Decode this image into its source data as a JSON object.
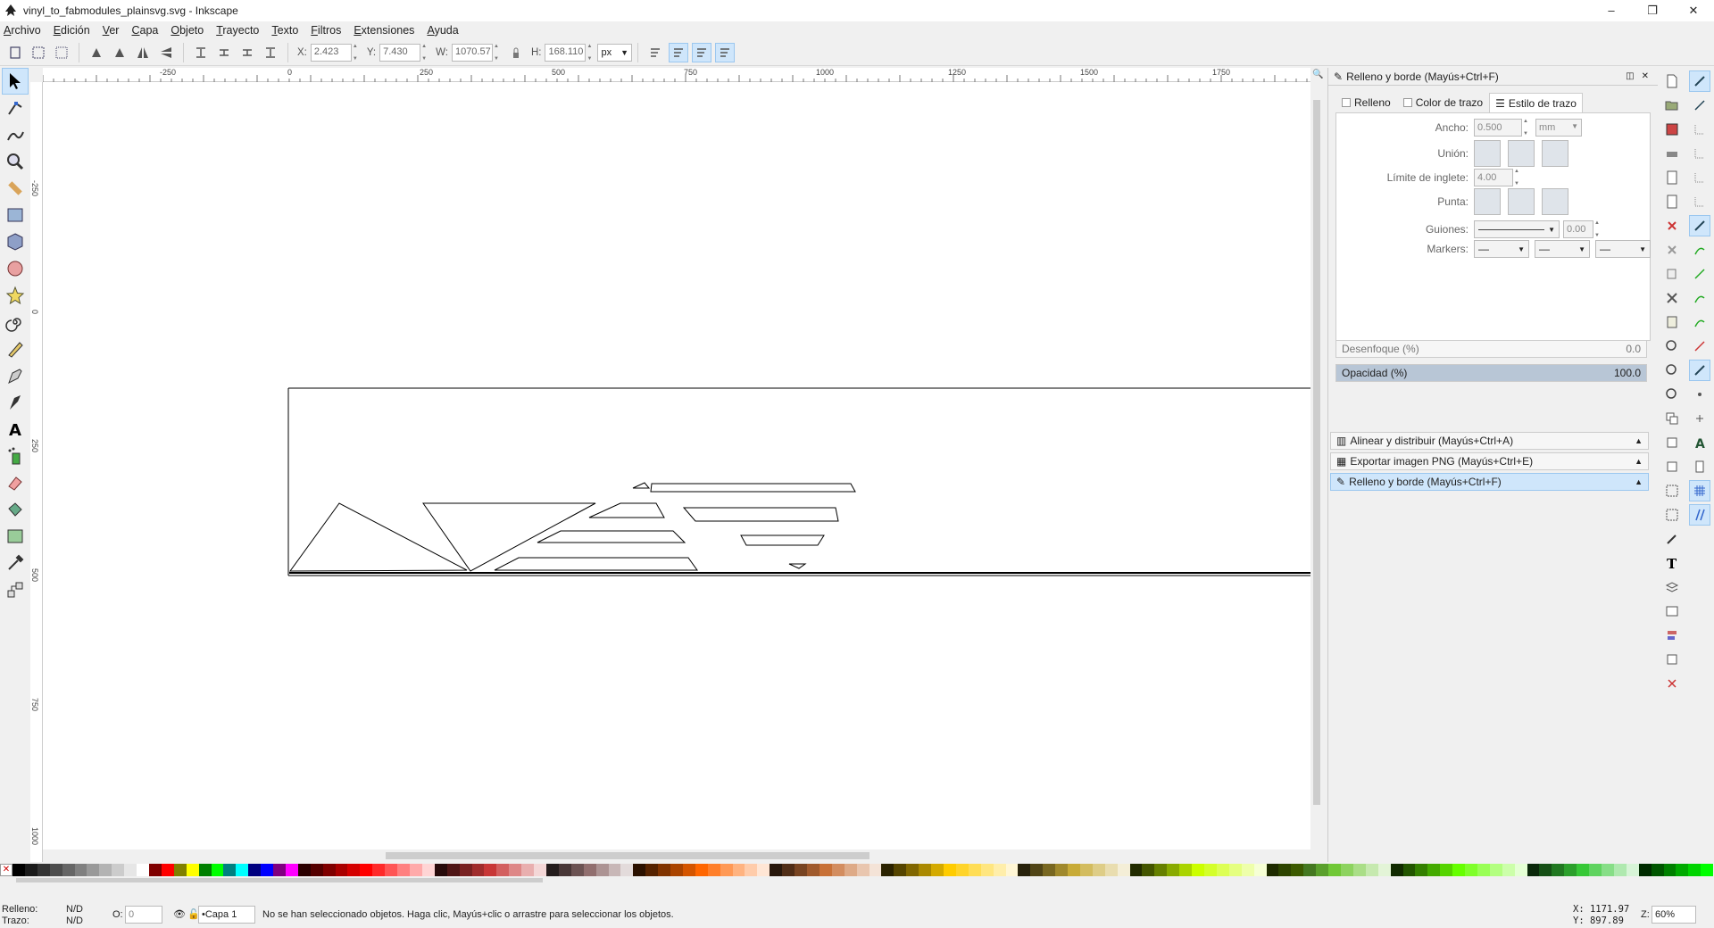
{
  "window": {
    "title": "vinyl_to_fabmodules_plainsvg.svg - Inkscape",
    "minimize": "–",
    "maximize": "❐",
    "close": "✕"
  },
  "menu": [
    "Archivo",
    "Edición",
    "Ver",
    "Capa",
    "Objeto",
    "Trayecto",
    "Texto",
    "Filtros",
    "Extensiones",
    "Ayuda"
  ],
  "toolbar": {
    "x_label": "X:",
    "x_value": "2.423",
    "y_label": "Y:",
    "y_value": "7.430",
    "w_label": "W:",
    "w_value": "1070.57",
    "h_label": "H:",
    "h_value": "168.110",
    "unit": "px"
  },
  "ruler": {
    "h_labels": [
      "-250",
      "0",
      "250",
      "500",
      "750",
      "1000",
      "1250",
      "1500",
      "1750"
    ],
    "v_labels": [
      "-250",
      "0",
      "250",
      "500",
      "750",
      "1000"
    ]
  },
  "dock": {
    "title": "Relleno y borde (Mayús+Ctrl+F)",
    "tabs": [
      "Relleno",
      "Color de trazo",
      "Estilo de trazo"
    ],
    "stroke": {
      "width_label": "Ancho:",
      "width_value": "0.500",
      "width_unit": "mm",
      "join_label": "Unión:",
      "miter_label": "Límite de inglete:",
      "miter_value": "4.00",
      "cap_label": "Punta:",
      "dashes_label": "Guiones:",
      "dashes_value": "0.00",
      "markers_label": "Markers:",
      "marker_value": "—"
    },
    "blur_label": "Desenfoque (%)",
    "blur_value": "0.0",
    "opacity_label": "Opacidad (%)",
    "opacity_value": "100.0",
    "panels": [
      "Alinear y distribuir (Mayús+Ctrl+A)",
      "Exportar imagen PNG (Mayús+Ctrl+E)",
      "Relleno y borde (Mayús+Ctrl+F)"
    ]
  },
  "status": {
    "fill_label": "Relleno:",
    "fill_value": "N/D",
    "stroke_label": "Trazo:",
    "stroke_value": "N/D",
    "opacity_label": "O:",
    "opacity_value": "0",
    "layer": "•Capa 1",
    "message": "No se han seleccionado objetos. Haga clic, Mayús+clic o arrastre para seleccionar los objetos.",
    "coord_x": "X: 1171.97",
    "coord_y": "Y:  897.89",
    "zoom_label": "Z:",
    "zoom_value": "60%"
  },
  "palette_colors": [
    "#000000",
    "#1a1a1a",
    "#333333",
    "#4d4d4d",
    "#666666",
    "#808080",
    "#999999",
    "#b3b3b3",
    "#cccccc",
    "#e6e6e6",
    "#ffffff",
    "#800000",
    "#ff0000",
    "#808000",
    "#ffff00",
    "#008000",
    "#00ff00",
    "#008080",
    "#00ffff",
    "#000080",
    "#0000ff",
    "#800080",
    "#ff00ff",
    "#2b0000",
    "#550000",
    "#800000",
    "#aa0000",
    "#d40000",
    "#ff0000",
    "#ff2a2a",
    "#ff5555",
    "#ff8080",
    "#ffaaaa",
    "#ffd5d5",
    "#280b0b",
    "#501616",
    "#782121",
    "#a02c2c",
    "#c83737",
    "#d35f5f",
    "#de8787",
    "#e9afaf",
    "#f4d7d7",
    "#241c1c",
    "#483737",
    "#6c5353",
    "#916f6f",
    "#ac9393",
    "#c8b7b7",
    "#e3dbdb",
    "#2b1100",
    "#552200",
    "#803300",
    "#aa4400",
    "#d45500",
    "#ff6600",
    "#ff7f2a",
    "#ff9955",
    "#ffb380",
    "#ffccaa",
    "#ffe6d5",
    "#28170b",
    "#502d16",
    "#784421",
    "#a05a2c",
    "#c87137",
    "#d38d5f",
    "#deaa87",
    "#e9c6af",
    "#f4e3d7",
    "#2b2200",
    "#554400",
    "#806600",
    "#aa8800",
    "#d4aa00",
    "#ffcc00",
    "#ffd42a",
    "#ffdd55",
    "#ffe680",
    "#ffeeaa",
    "#fff6d5",
    "#28220b",
    "#504416",
    "#786721",
    "#a0892c",
    "#c8ab37",
    "#d3bc5f",
    "#decd87",
    "#e9ddaf",
    "#f4eed7",
    "#222b00",
    "#445500",
    "#668000",
    "#88aa00",
    "#aad400",
    "#ccff00",
    "#d4ff2a",
    "#ddff55",
    "#e5ff80",
    "#eeffaa",
    "#f6ffd5",
    "#1e2b00",
    "#2d4400",
    "#3c5a00",
    "#447821",
    "#5aa02c",
    "#71c837",
    "#8dd35f",
    "#aade87",
    "#c6e9af",
    "#e3f4d7",
    "#112b00",
    "#225500",
    "#338000",
    "#44aa00",
    "#55d400",
    "#66ff00",
    "#7fff2a",
    "#99ff55",
    "#b3ff80",
    "#ccffaa",
    "#e5ffd5",
    "#0b280b",
    "#165016",
    "#217821",
    "#2ca02c",
    "#37c837",
    "#5fd35f",
    "#87de87",
    "#afe9af",
    "#d7f4d7",
    "#002b00",
    "#005500",
    "#008000",
    "#00aa00",
    "#00d400",
    "#00ff00"
  ]
}
